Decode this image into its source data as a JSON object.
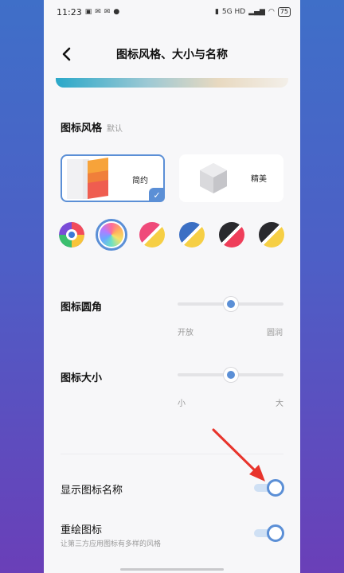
{
  "status_bar": {
    "time": "11:23",
    "left_icons": [
      "image-icon",
      "mail-icon",
      "email-icon",
      "chat-icon"
    ],
    "right_text": "5G HD",
    "battery": "75"
  },
  "header": {
    "title": "图标风格、大小与名称"
  },
  "icon_style": {
    "title": "图标风格",
    "current": "默认",
    "cards": [
      {
        "label": "简约",
        "selected": true
      },
      {
        "label": "精美",
        "selected": false
      }
    ]
  },
  "colors": {
    "swatches": [
      {
        "name": "multicolor"
      },
      {
        "name": "rainbow-gradient",
        "selected": true
      },
      {
        "name": "pink-yellow"
      },
      {
        "name": "blue-yellow"
      },
      {
        "name": "black-red"
      },
      {
        "name": "black-yellow"
      }
    ]
  },
  "corner": {
    "label": "图标圆角",
    "min_label": "开放",
    "max_label": "圆润",
    "value": 0.5
  },
  "size": {
    "label": "图标大小",
    "min_label": "小",
    "max_label": "大",
    "value": 0.5
  },
  "show_names": {
    "label": "显示图标名称",
    "enabled": true
  },
  "redraw": {
    "label": "重绘图标",
    "desc": "让第三方应用图标有多样的风格",
    "enabled": true
  },
  "accent_color": "#5b8fd6",
  "annotation_color": "#e8342c"
}
